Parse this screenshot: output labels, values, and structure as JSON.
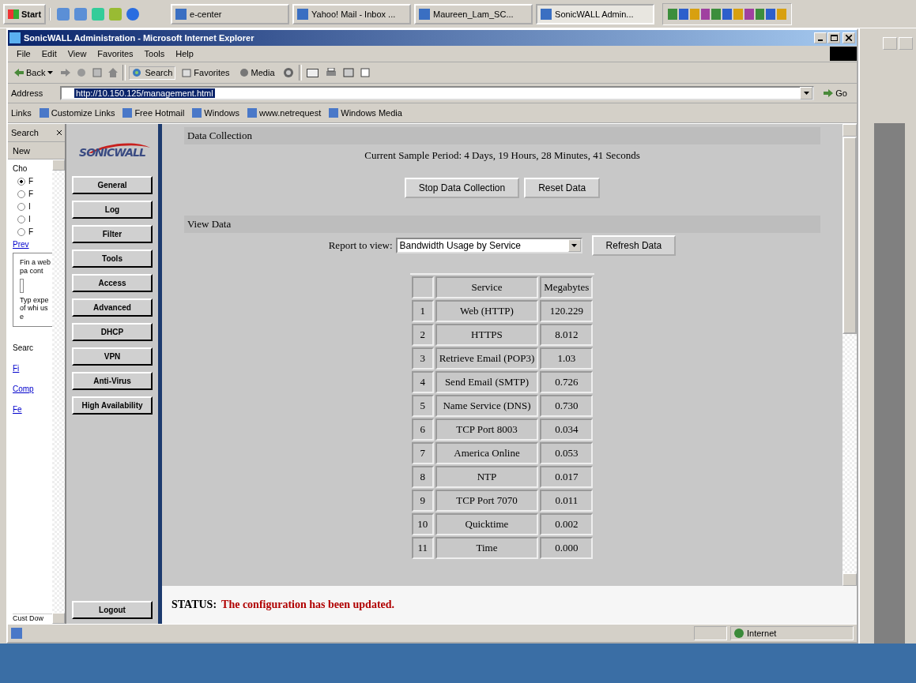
{
  "taskbar": {
    "start": "Start",
    "tasks": [
      {
        "label": "e-center",
        "selected": false
      },
      {
        "label": "Yahoo! Mail - Inbox ...",
        "selected": false
      },
      {
        "label": "Maureen_Lam_SC...",
        "selected": false
      },
      {
        "label": "SonicWALL Admin...",
        "selected": true
      }
    ]
  },
  "window": {
    "title": "SonicWALL Administration - Microsoft Internet Explorer"
  },
  "menu": [
    "File",
    "Edit",
    "View",
    "Favorites",
    "Tools",
    "Help"
  ],
  "toolbar": {
    "back": "Back",
    "search": "Search",
    "favorites": "Favorites",
    "media": "Media"
  },
  "address": {
    "label": "Address",
    "value": "http://10.150.125/management.html",
    "go": "Go"
  },
  "links": {
    "label": "Links",
    "items": [
      "Customize Links",
      "Free Hotmail",
      "Windows",
      "www.netrequest",
      "Windows Media"
    ]
  },
  "search_pane": {
    "title": "Search",
    "new": "New",
    "prompt": "Cho",
    "options": [
      {
        "label": "F",
        "checked": true
      },
      {
        "label": "F",
        "checked": false
      },
      {
        "label": "I",
        "checked": false
      },
      {
        "label": "I",
        "checked": false
      },
      {
        "label": "F",
        "checked": false
      }
    ],
    "prev": "Prev",
    "box_lines": [
      "Fin",
      "a",
      "web",
      "pa",
      "cont"
    ],
    "box_lines_2": [
      "Typ",
      "expe",
      "of",
      "whi",
      "use"
    ],
    "search_label": "Searc",
    "bottom_links": [
      "Fi",
      "Comp",
      "Fe"
    ],
    "footer": [
      "Cust",
      "Dow"
    ]
  },
  "nav": {
    "logo": "SONICWALL",
    "items": [
      {
        "label": "General"
      },
      {
        "label": "Log"
      },
      {
        "label": "Filter"
      },
      {
        "label": "Tools"
      },
      {
        "label": "Access"
      },
      {
        "label": "Advanced"
      },
      {
        "label": "DHCP"
      },
      {
        "label": "VPN"
      },
      {
        "label": "Anti-Virus"
      },
      {
        "label": "High Availability"
      }
    ],
    "logout": "Logout"
  },
  "data_collection": {
    "heading": "Data Collection",
    "sample_period": "Current Sample Period: 4 Days, 19 Hours, 28 Minutes, 41 Seconds",
    "buttons": [
      "Stop Data Collection",
      "Reset Data"
    ]
  },
  "view_data": {
    "heading": "View Data",
    "report_label": "Report to view:",
    "report_value": "Bandwidth Usage by Service",
    "refresh": "Refresh Data"
  },
  "table": {
    "columns": [
      "",
      "Service",
      "Megabytes"
    ],
    "rows": [
      [
        "1",
        "Web (HTTP)",
        "120.229"
      ],
      [
        "2",
        "HTTPS",
        "8.012"
      ],
      [
        "3",
        "Retrieve Email (POP3)",
        "1.03"
      ],
      [
        "4",
        "Send Email (SMTP)",
        "0.726"
      ],
      [
        "5",
        "Name Service (DNS)",
        "0.730"
      ],
      [
        "6",
        "TCP Port 8003",
        "0.034"
      ],
      [
        "7",
        "America Online",
        "0.053"
      ],
      [
        "8",
        "NTP",
        "0.017"
      ],
      [
        "9",
        "TCP Port 7070",
        "0.011"
      ],
      [
        "10",
        "Quicktime",
        "0.002"
      ],
      [
        "11",
        "Time",
        "0.000"
      ]
    ]
  },
  "status": {
    "label": "STATUS:",
    "message": "The configuration has been updated."
  },
  "status_bar": {
    "zone": "Internet"
  }
}
